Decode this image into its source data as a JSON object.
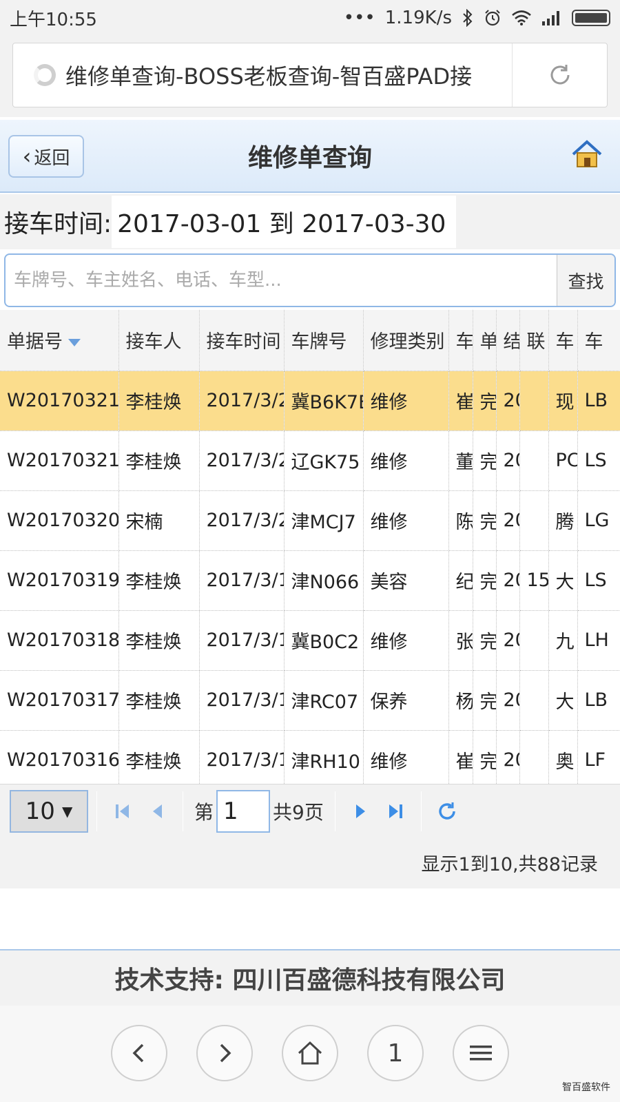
{
  "status_bar": {
    "time": "上午10:55",
    "dots": "•••",
    "speed": "1.19K/s"
  },
  "browser": {
    "page_title": "维修单查询-BOSS老板查询-智百盛PAD接"
  },
  "header": {
    "back_label": "返回",
    "title": "维修单查询"
  },
  "filter": {
    "date_label": "接车时间:",
    "date_range": "2017-03-01 到 2017-03-30"
  },
  "search": {
    "placeholder": "车牌号、车主姓名、电话、车型...",
    "button_label": "查找"
  },
  "grid": {
    "columns": [
      "单据号",
      "接车人",
      "接车时间",
      "车牌号",
      "修理类别",
      "车",
      "单",
      "结",
      "联",
      "车",
      "车"
    ],
    "rows": [
      [
        "W20170321",
        "李桂焕",
        "2017/3/2",
        "冀B6K7E",
        "维修",
        "崔",
        "完",
        "20",
        "",
        "现",
        "LB"
      ],
      [
        "W20170321",
        "李桂焕",
        "2017/3/2",
        "辽GK75",
        "维修",
        "董",
        "完",
        "20",
        "",
        "PC",
        "LS"
      ],
      [
        "W20170320",
        "宋楠",
        "2017/3/2",
        "津MCJ7",
        "维修",
        "陈",
        "完",
        "20",
        "",
        "腾",
        "LG"
      ],
      [
        "W20170319",
        "李桂焕",
        "2017/3/1",
        "津N066",
        "美容",
        "纪",
        "完",
        "20",
        "15",
        "大",
        "LS"
      ],
      [
        "W20170318",
        "李桂焕",
        "2017/3/1",
        "冀B0C2",
        "维修",
        "张",
        "完",
        "20",
        "",
        "九",
        "LH"
      ],
      [
        "W20170317",
        "李桂焕",
        "2017/3/1",
        "津RC07",
        "保养",
        "杨",
        "完",
        "20",
        "",
        "大",
        "LB"
      ],
      [
        "W20170316",
        "李桂焕",
        "2017/3/1",
        "津RH10",
        "维修",
        "崔",
        "完",
        "20",
        "",
        "奥",
        "LF"
      ]
    ]
  },
  "pager": {
    "page_size": "10",
    "page_prefix": "第",
    "current_page": "1",
    "total_pages": "共9页",
    "info": "显示1到10,共88记录"
  },
  "footer": {
    "tech_support": "技术支持: 四川百盛德科技有限公司",
    "page_button": "1",
    "watermark": "智百盛软件"
  },
  "colors": {
    "selected_row": "#fbdd8d",
    "header_gradient_top": "#eef5fd",
    "accent_blue": "#3d8ee6"
  }
}
